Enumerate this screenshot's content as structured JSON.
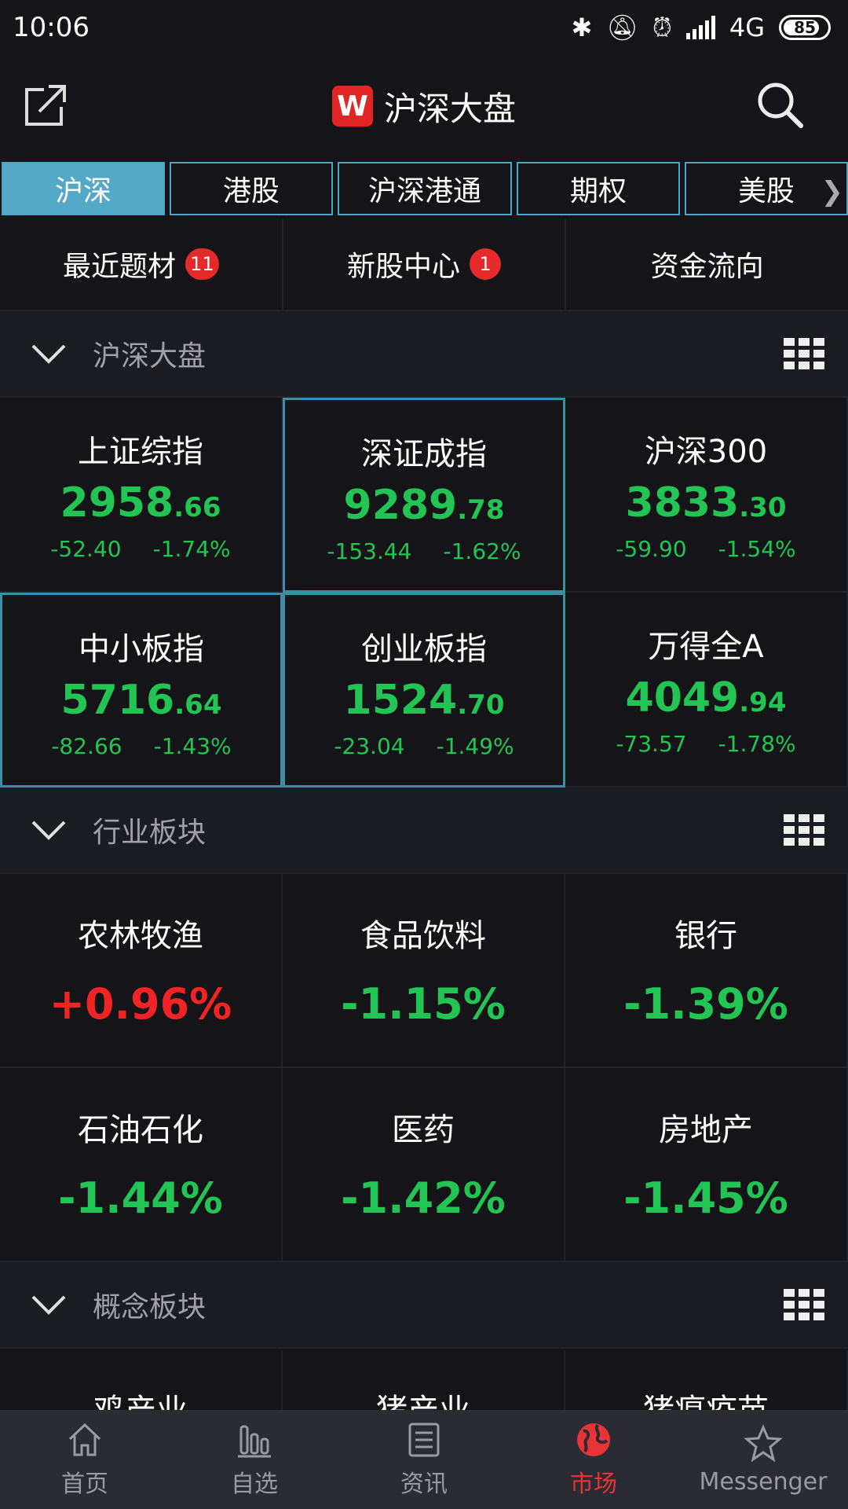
{
  "status_bar": {
    "time": "10:06",
    "network": "4G",
    "battery": "85",
    "battery_level": 0.85
  },
  "header": {
    "logo_letter": "W",
    "title": "沪深大盘"
  },
  "tabs": [
    {
      "label": "沪深",
      "active": true
    },
    {
      "label": "港股",
      "active": false
    },
    {
      "label": "沪深港通",
      "active": false
    },
    {
      "label": "期权",
      "active": false
    },
    {
      "label": "美股",
      "active": false
    }
  ],
  "shortcuts": [
    {
      "label": "最近题材",
      "badge": "11"
    },
    {
      "label": "新股中心",
      "badge": "1"
    },
    {
      "label": "资金流向",
      "badge": ""
    }
  ],
  "sections": {
    "market": "沪深大盘",
    "industry": "行业板块",
    "concept": "概念板块"
  },
  "indices": [
    {
      "name": "上证综指",
      "int": "2958",
      "dec": ".66",
      "change": "-52.40",
      "pct": "-1.74%"
    },
    {
      "name": "深证成指",
      "int": "9289",
      "dec": ".78",
      "change": "-153.44",
      "pct": "-1.62%"
    },
    {
      "name": "沪深300",
      "int": "3833",
      "dec": ".30",
      "change": "-59.90",
      "pct": "-1.54%"
    },
    {
      "name": "中小板指",
      "int": "5716",
      "dec": ".64",
      "change": "-82.66",
      "pct": "-1.43%"
    },
    {
      "name": "创业板指",
      "int": "1524",
      "dec": ".70",
      "change": "-23.04",
      "pct": "-1.49%"
    },
    {
      "name": "万得全A",
      "int": "4049",
      "dec": ".94",
      "change": "-73.57",
      "pct": "-1.78%"
    }
  ],
  "sectors": [
    {
      "name": "农林牧渔",
      "pct": "+0.96%"
    },
    {
      "name": "食品饮料",
      "pct": "-1.15%"
    },
    {
      "name": "银行",
      "pct": "-1.39%"
    },
    {
      "name": "石油石化",
      "pct": "-1.44%"
    },
    {
      "name": "医药",
      "pct": "-1.42%"
    },
    {
      "name": "房地产",
      "pct": "-1.45%"
    }
  ],
  "concepts": [
    {
      "name": "鸡产业"
    },
    {
      "name": "猪产业"
    },
    {
      "name": "猪瘟疫苗"
    }
  ],
  "bottom_nav": [
    {
      "label": "首页",
      "icon": "home-icon"
    },
    {
      "label": "自选",
      "icon": "chart-icon"
    },
    {
      "label": "资讯",
      "icon": "news-icon"
    },
    {
      "label": "市场",
      "icon": "globe-icon",
      "active": true
    },
    {
      "label": "Messenger",
      "icon": "messenger-icon"
    }
  ],
  "colors": {
    "down": "#22c553",
    "up": "#f02424",
    "accent": "#55a9c8",
    "brand": "#e22626"
  }
}
